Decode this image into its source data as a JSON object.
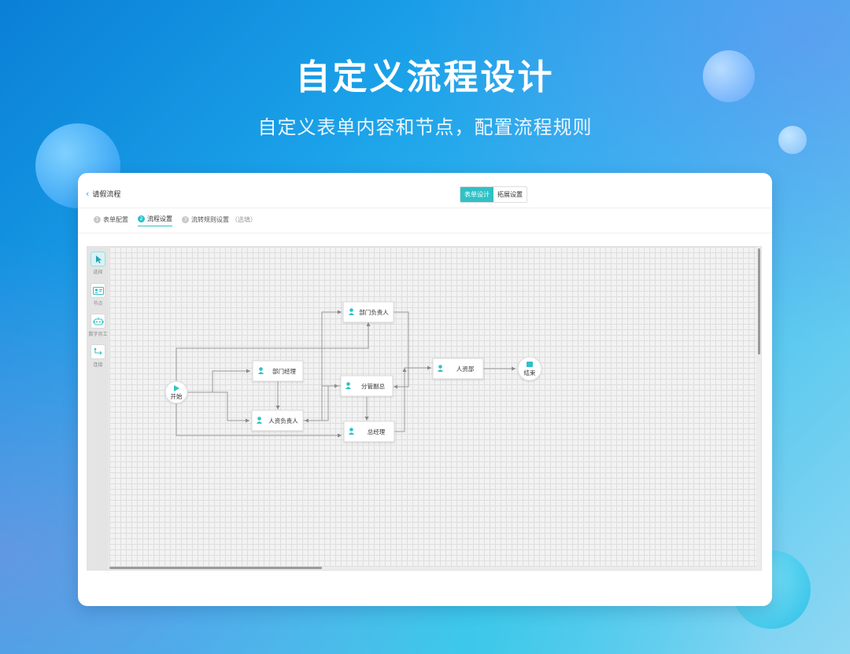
{
  "hero": {
    "title": "自定义流程设计",
    "subtitle": "自定义表单内容和节点，配置流程规则"
  },
  "header": {
    "back_label": "请假流程",
    "tabs": [
      {
        "label": "表单设计",
        "active": true
      },
      {
        "label": "拓展设置",
        "active": false
      }
    ]
  },
  "steps": [
    {
      "num": "1",
      "label": "表单配置",
      "hint": "",
      "active": false
    },
    {
      "num": "2",
      "label": "流程设置",
      "hint": "",
      "active": true
    },
    {
      "num": "3",
      "label": "流转规则设置",
      "hint": "（选填）",
      "active": false
    }
  ],
  "toolbox": [
    {
      "label": "选择",
      "icon": "cursor-icon",
      "active": true
    },
    {
      "label": "节点",
      "icon": "user-card-icon",
      "active": false
    },
    {
      "label": "数字员工",
      "icon": "robot-icon",
      "active": false
    },
    {
      "label": "连接",
      "icon": "connect-icon",
      "active": false
    }
  ],
  "flow": {
    "start_label": "开始",
    "end_label": "结束",
    "nodes": [
      {
        "id": "dept_head",
        "label": "部门负责人"
      },
      {
        "id": "dept_mgr",
        "label": "部门经理"
      },
      {
        "id": "hr_head",
        "label": "人资负责人"
      },
      {
        "id": "vp",
        "label": "分管副总"
      },
      {
        "id": "gm",
        "label": "总经理"
      },
      {
        "id": "hr_dept",
        "label": "人资部"
      }
    ]
  },
  "colors": {
    "accent": "#2fc1c6",
    "back_icon": "#39a4d9"
  }
}
